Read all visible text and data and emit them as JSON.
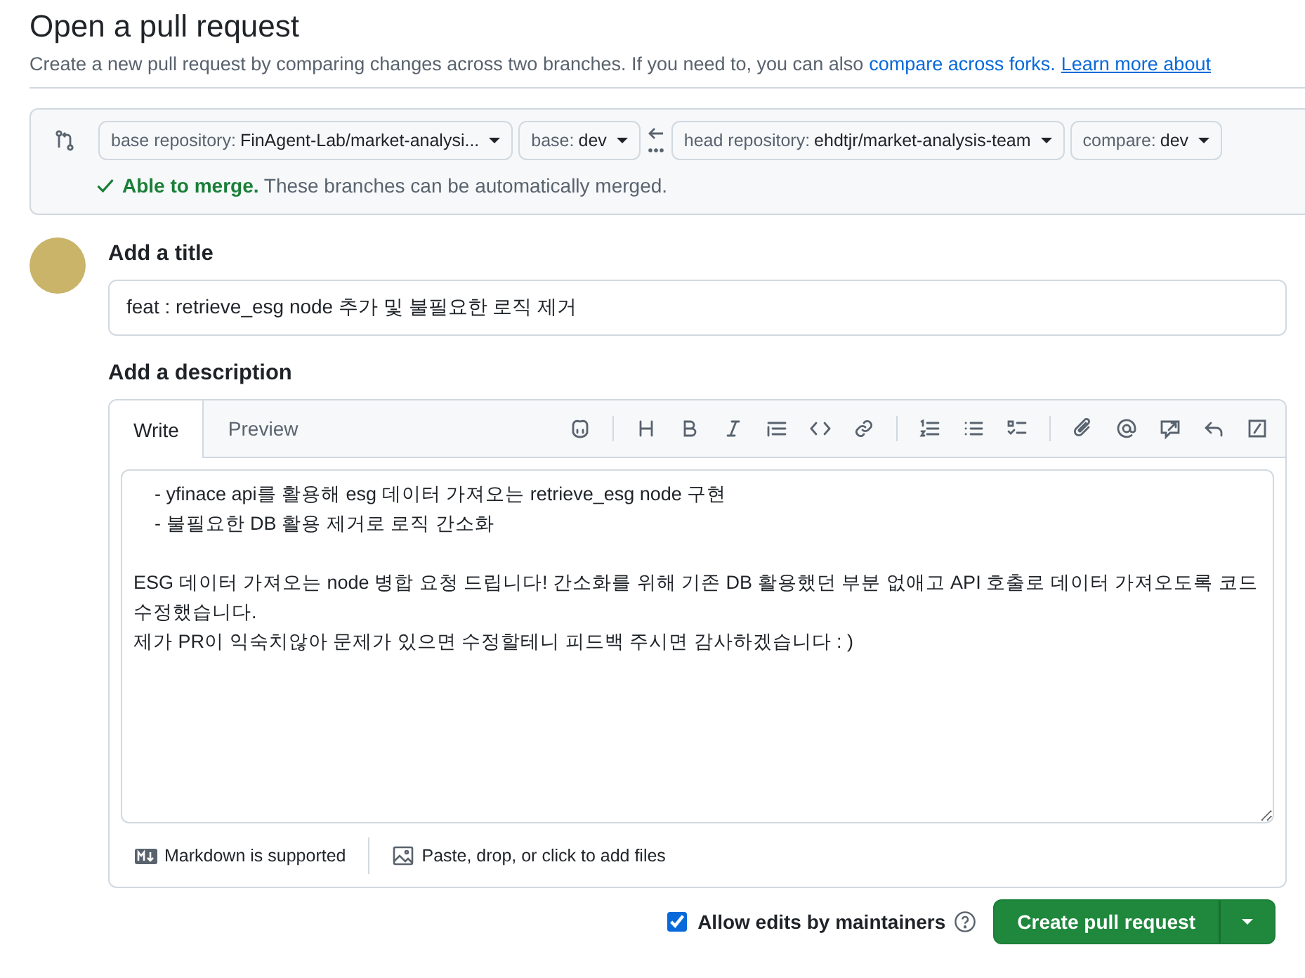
{
  "header": {
    "title": "Open a pull request",
    "subtitle": "Create a new pull request by comparing changes across two branches. If you need to, you can also",
    "link": "compare across forks.",
    "learn_more": "Learn more about"
  },
  "compare": {
    "selectors": [
      {
        "label": "base repository:",
        "value": "FinAgent-Lab/market-analysi..."
      },
      {
        "label": "base:",
        "value": "dev"
      },
      {
        "label": "head repository:",
        "value": "ehdtjr/market-analysis-team"
      },
      {
        "label": "compare:",
        "value": "dev"
      }
    ],
    "merge_status": {
      "title": "Able to merge.",
      "text": "These branches can be automatically merged."
    }
  },
  "title_section": {
    "heading": "Add a title",
    "value": "feat : retrieve_esg node 추가 및 불필요한 로직 제거"
  },
  "description_section": {
    "heading": "Add a description",
    "tabs": [
      {
        "label": "Write",
        "selected": true
      },
      {
        "label": "Preview",
        "selected": false
      }
    ],
    "value": "    - yfinace api를 활용해 esg 데이터 가져오는 retrieve_esg node 구현\n    - 불필요한 DB 활용 제거로 로직 간소화\n\nESG 데이터 가져오는 node 병합 요청 드립니다! 간소화를 위해 기존 DB 활용했던 부분 없애고 API 호출로 데이터 가져오도록 코드 수정했습니다.\n제가 PR이 익숙치않아 문제가 있으면 수정할테니 피드백 주시면 감사하겠습니다 : )",
    "markdown_note": "Markdown is supported",
    "attach_note": "Paste, drop, or click to add files"
  },
  "allow_edits": {
    "label": "Allow edits by maintainers",
    "checked": true
  },
  "submit": {
    "label": "Create pull request"
  }
}
